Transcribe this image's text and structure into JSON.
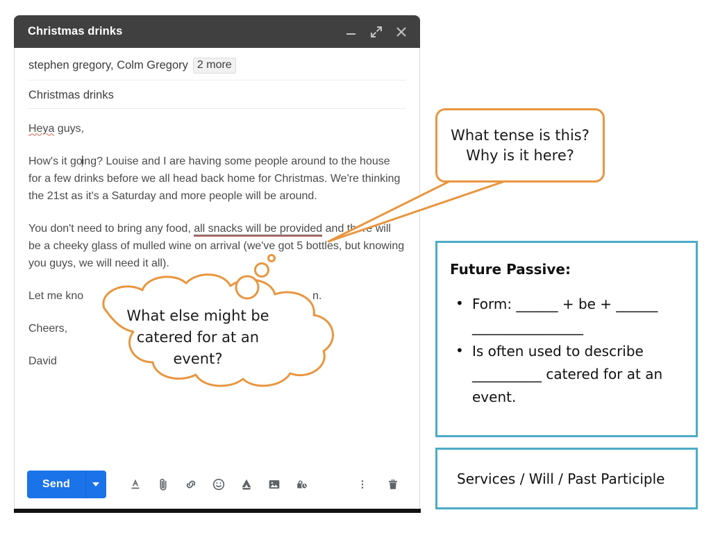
{
  "compose": {
    "title": "Christmas drinks",
    "window_buttons": [
      {
        "name": "minimize",
        "label": "Minimize"
      },
      {
        "name": "expand",
        "label": "Full screen"
      },
      {
        "name": "close",
        "label": "Save & close"
      }
    ],
    "recipients": "stephen gregory, Colm Gregory",
    "more_chip": "2 more",
    "subject": "Christmas drinks",
    "body": {
      "greeting_misspelled": "Heya",
      "greeting_rest": " guys,",
      "paragraph_1_before_caret": "How's it go",
      "paragraph_1_after_caret": "ing? Louise and I are having some people around to the house for a few drinks before we all head back home for Christmas. We're thinking the 21st as it's a Saturday and more people will be around.",
      "paragraph_2_start": "You don't need to bring any food, ",
      "paragraph_2_highlight": "all snacks will be provided",
      "paragraph_2_end": " and there will be a cheeky glass of mulled wine on arrival (we've got 5 bottles, but knowing you guys, we will need it all).",
      "paragraph_3_visible_start": "Let me kno",
      "paragraph_3_visible_end": "n.",
      "sign_off": "Cheers,",
      "signature": "David"
    },
    "toolbar": {
      "send_label": "Send",
      "send_dropdown": "send-options",
      "icons": [
        "format-text-icon",
        "attach-file-icon",
        "insert-link-icon",
        "insert-emoji-icon",
        "insert-drive-icon",
        "insert-photo-icon",
        "confidential-mode-icon"
      ],
      "more_options": "more-options-icon",
      "discard": "discard-draft-icon"
    }
  },
  "annotations": {
    "speech_bubble": {
      "line1": "What tense is this?",
      "line2": "Why is it here?",
      "color": "#e8963f"
    },
    "thought_cloud": {
      "line1": "What else might be",
      "line2": "catered for at an",
      "line3": "event?",
      "color": "#e8963f"
    }
  },
  "grammar_box": {
    "border_color": "#4cabc6",
    "heading": "Future Passive:",
    "bullets": [
      {
        "parts": [
          "Form: ",
          "______",
          " + be + ",
          "______",
          " ________________"
        ]
      },
      {
        "parts": [
          "Is often used to describe ",
          "__________",
          " catered for at an event."
        ]
      }
    ],
    "bullet_1_text": "Form: ______ + be + ______ ________________",
    "bullet_2_text": "Is often used to describe __________ catered for at an event."
  },
  "answers_box": {
    "border_color": "#4cabc6",
    "text": "Services / Will / Past Participle"
  }
}
